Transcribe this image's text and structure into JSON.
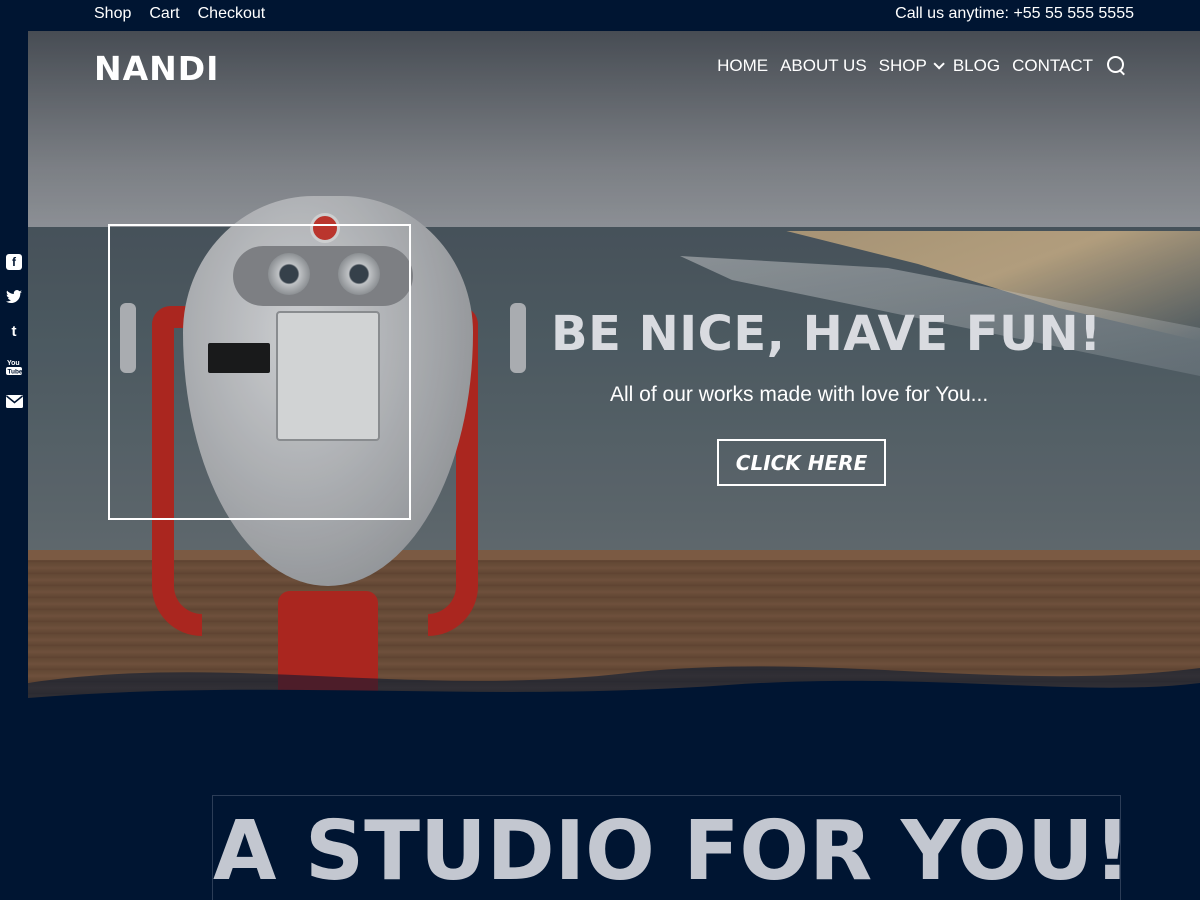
{
  "topbar": {
    "links": [
      "Shop",
      "Cart",
      "Checkout"
    ],
    "phone": "Call us anytime: +55 55 555 5555"
  },
  "social": {
    "icons": [
      "facebook-icon",
      "twitter-icon",
      "tumblr-icon",
      "youtube-icon",
      "email-icon"
    ]
  },
  "header": {
    "logo": "NANDI",
    "nav": [
      "HOME",
      "ABOUT US",
      "SHOP",
      "BLOG",
      "CONTACT"
    ]
  },
  "hero": {
    "headline": "BE NICE, HAVE FUN!",
    "subline": "All of our works made with love for You...",
    "cta": "CLICK HERE"
  },
  "studio": {
    "title": "A STUDIO FOR YOU!"
  },
  "colors": {
    "background": "#001532",
    "headline": "#d9dbe0",
    "studio_title": "#c3c7d0"
  }
}
